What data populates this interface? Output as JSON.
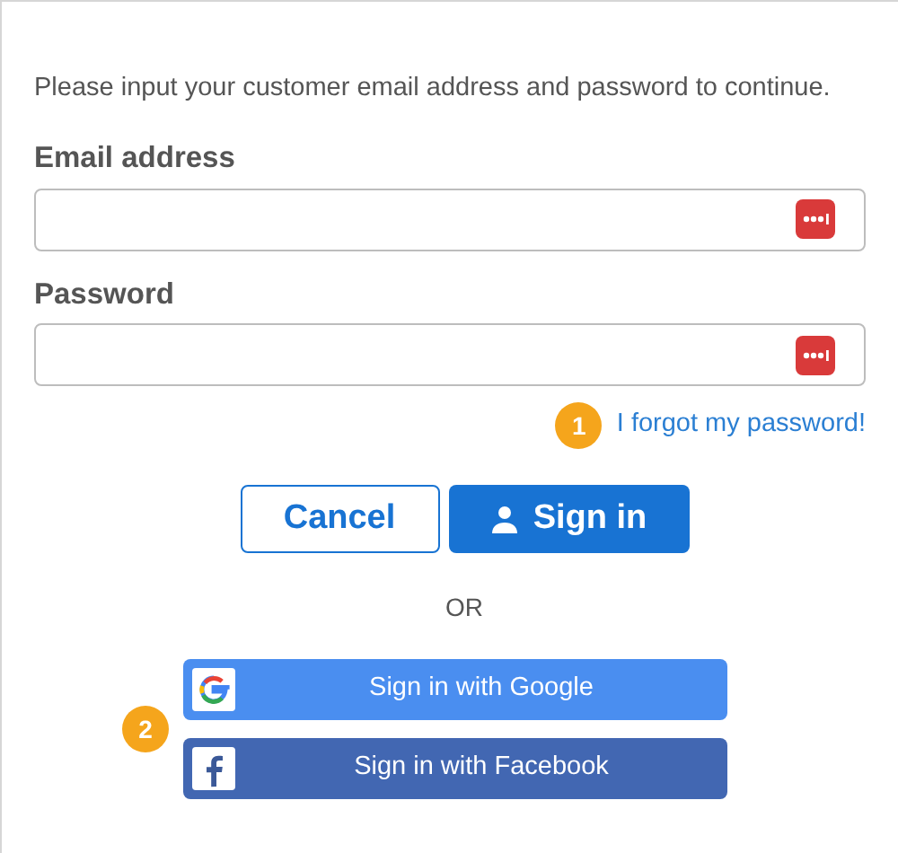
{
  "instruction": "Please input your customer email address and password to continue.",
  "fields": [
    {
      "label": "Email address"
    },
    {
      "label": "Password"
    }
  ],
  "forgot_link": {
    "text": "I forgot my password!",
    "badge": "1"
  },
  "buttons": [
    {
      "label": "Cancel",
      "kind": "secondary"
    },
    {
      "label": "Sign in",
      "kind": "primary"
    }
  ],
  "separator": "OR",
  "social_badge": "2",
  "social_buttons": [
    {
      "label": "Sign in with Google",
      "kind": "google"
    },
    {
      "label": "Sign in with Facebook",
      "kind": "facebook"
    }
  ]
}
